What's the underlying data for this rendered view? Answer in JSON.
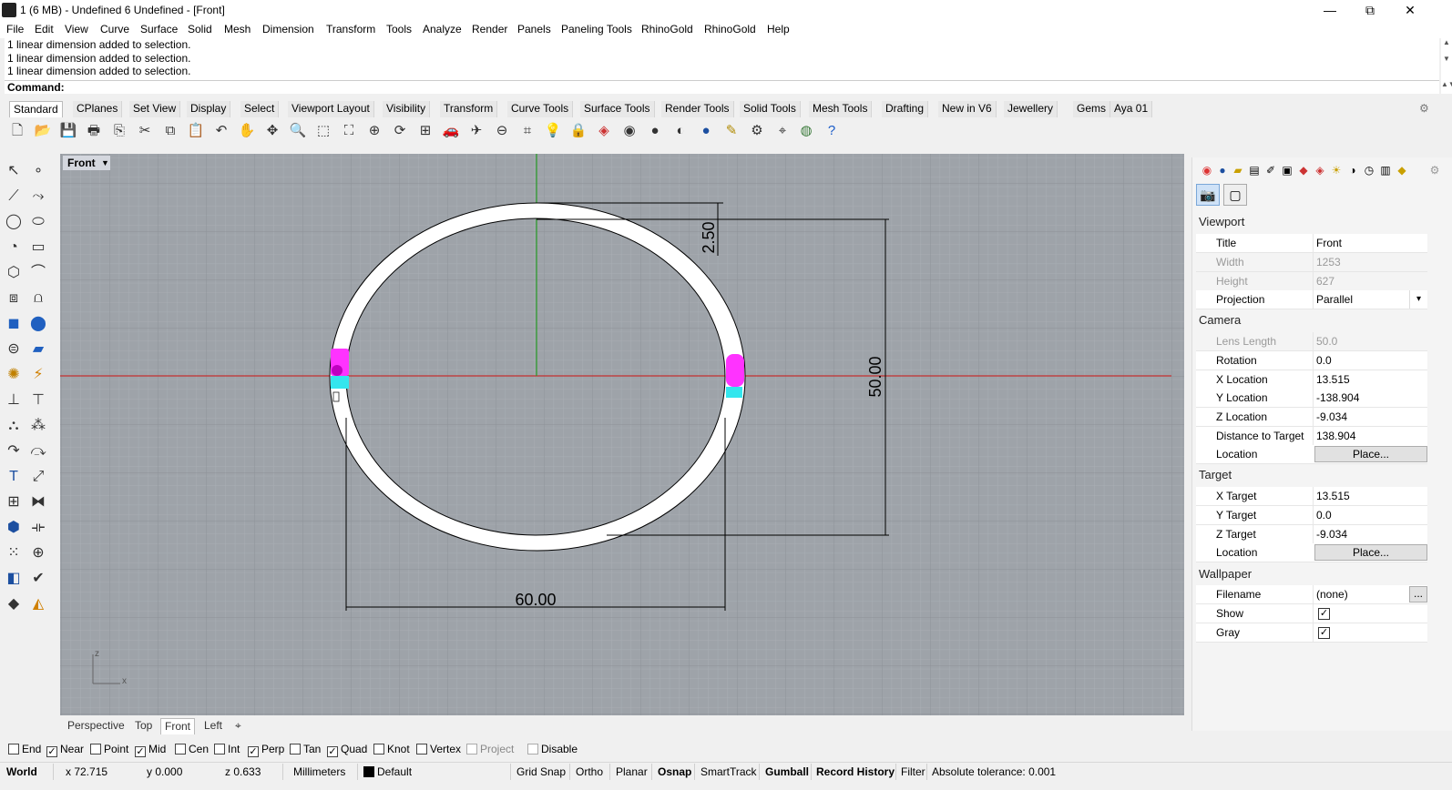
{
  "window": {
    "title": "1 (6 MB) - Undefined 6 Undefined - [Front]",
    "minimize": "—",
    "restore": "⧉",
    "close": "✕"
  },
  "menu": [
    "File",
    "Edit",
    "View",
    "Curve",
    "Surface",
    "Solid",
    "Mesh",
    "Dimension",
    "Transform",
    "Tools",
    "Analyze",
    "Render",
    "Panels",
    "Paneling Tools",
    "RhinoGold",
    "RhinoGold",
    "Help"
  ],
  "command_history": [
    "1 linear dimension added to selection.",
    "1 linear dimension added to selection.",
    "1 linear dimension added to selection."
  ],
  "command_prompt": "Command:",
  "toolbar_tabs": [
    "Standard",
    "CPlanes",
    "Set View",
    "Display",
    "Select",
    "Viewport Layout",
    "Visibility",
    "Transform",
    "Curve Tools",
    "Surface Tools",
    "Render Tools",
    "Solid Tools",
    "Mesh Tools",
    "Drafting",
    "New in V6",
    "Jewellery",
    "Gems",
    "Aya 01"
  ],
  "toolbar_icons": [
    "new-file-icon",
    "open-file-icon",
    "save-icon",
    "print-icon",
    "import-icon",
    "cut-icon",
    "copy-icon",
    "paste-icon",
    "undo-icon",
    "pan-icon",
    "move-view-icon",
    "zoom-icon",
    "zoom-window-icon",
    "zoom-extents-icon",
    "zoom-selected-icon",
    "rotate-view-icon",
    "four-viewports-icon",
    "car-icon",
    "plane-icon",
    "cplane-icon",
    "snap-icon",
    "lightbulb-icon",
    "lock-icon",
    "layer-icon",
    "color-wheel-icon",
    "sphere-icon",
    "render-icon",
    "globe-icon",
    "pen-icon",
    "gears-icon",
    "dimension-icon",
    "environment-icon",
    "help-icon"
  ],
  "viewport": {
    "title": "Front",
    "dims": {
      "top": "2.50",
      "height": "50.00",
      "width": "60.00"
    },
    "axis": {
      "z": "z",
      "x": "x"
    }
  },
  "viewport_tabs": [
    "Perspective",
    "Top",
    "Front",
    "Left"
  ],
  "viewport_add": "⌖",
  "panel": {
    "sections": {
      "viewport": "Viewport",
      "camera": "Camera",
      "target": "Target",
      "wallpaper": "Wallpaper"
    },
    "viewport": {
      "title": {
        "label": "Title",
        "value": "Front"
      },
      "width": {
        "label": "Width",
        "value": "1253"
      },
      "height": {
        "label": "Height",
        "value": "627"
      },
      "projection": {
        "label": "Projection",
        "value": "Parallel"
      }
    },
    "camera": {
      "lens": {
        "label": "Lens Length",
        "value": "50.0"
      },
      "rotation": {
        "label": "Rotation",
        "value": "0.0"
      },
      "x": {
        "label": "X Location",
        "value": "13.515"
      },
      "y": {
        "label": "Y Location",
        "value": "-138.904"
      },
      "z": {
        "label": "Z Location",
        "value": "-9.034"
      },
      "dist": {
        "label": "Distance to Target",
        "value": "138.904"
      },
      "loc": {
        "label": "Location",
        "button": "Place..."
      }
    },
    "target": {
      "x": {
        "label": "X Target",
        "value": "13.515"
      },
      "y": {
        "label": "Y Target",
        "value": "0.0"
      },
      "z": {
        "label": "Z Target",
        "value": "-9.034"
      },
      "loc": {
        "label": "Location",
        "button": "Place..."
      }
    },
    "wallpaper": {
      "filename": {
        "label": "Filename",
        "value": "(none)",
        "button": "..."
      },
      "show": {
        "label": "Show",
        "checked": true
      },
      "gray": {
        "label": "Gray",
        "checked": true
      }
    }
  },
  "osnaps": [
    {
      "label": "End",
      "checked": false
    },
    {
      "label": "Near",
      "checked": true
    },
    {
      "label": "Point",
      "checked": false
    },
    {
      "label": "Mid",
      "checked": true
    },
    {
      "label": "Cen",
      "checked": false
    },
    {
      "label": "Int",
      "checked": false
    },
    {
      "label": "Perp",
      "checked": true
    },
    {
      "label": "Tan",
      "checked": false
    },
    {
      "label": "Quad",
      "checked": true
    },
    {
      "label": "Knot",
      "checked": false
    },
    {
      "label": "Vertex",
      "checked": false
    },
    {
      "label": "Project",
      "checked": false
    },
    {
      "label": "Disable",
      "checked": false
    }
  ],
  "status": {
    "cplane": "World",
    "x": "x 72.715",
    "y": "y 0.000",
    "z": "z 0.633",
    "units": "Millimeters",
    "layer": "Default",
    "grid_snap": "Grid Snap",
    "ortho": "Ortho",
    "planar": "Planar",
    "osnap": "Osnap",
    "smarttrack": "SmartTrack",
    "gumball": "Gumball",
    "record_history": "Record History",
    "filter": "Filter",
    "tolerance": "Absolute tolerance: 0.001"
  },
  "colors": {
    "viewport_bg": "#9ea3a9",
    "x_axis": "#c43030",
    "y_axis": "#2e9a2e",
    "selection": "#ff33ff",
    "highlight": "#33e6ee"
  }
}
